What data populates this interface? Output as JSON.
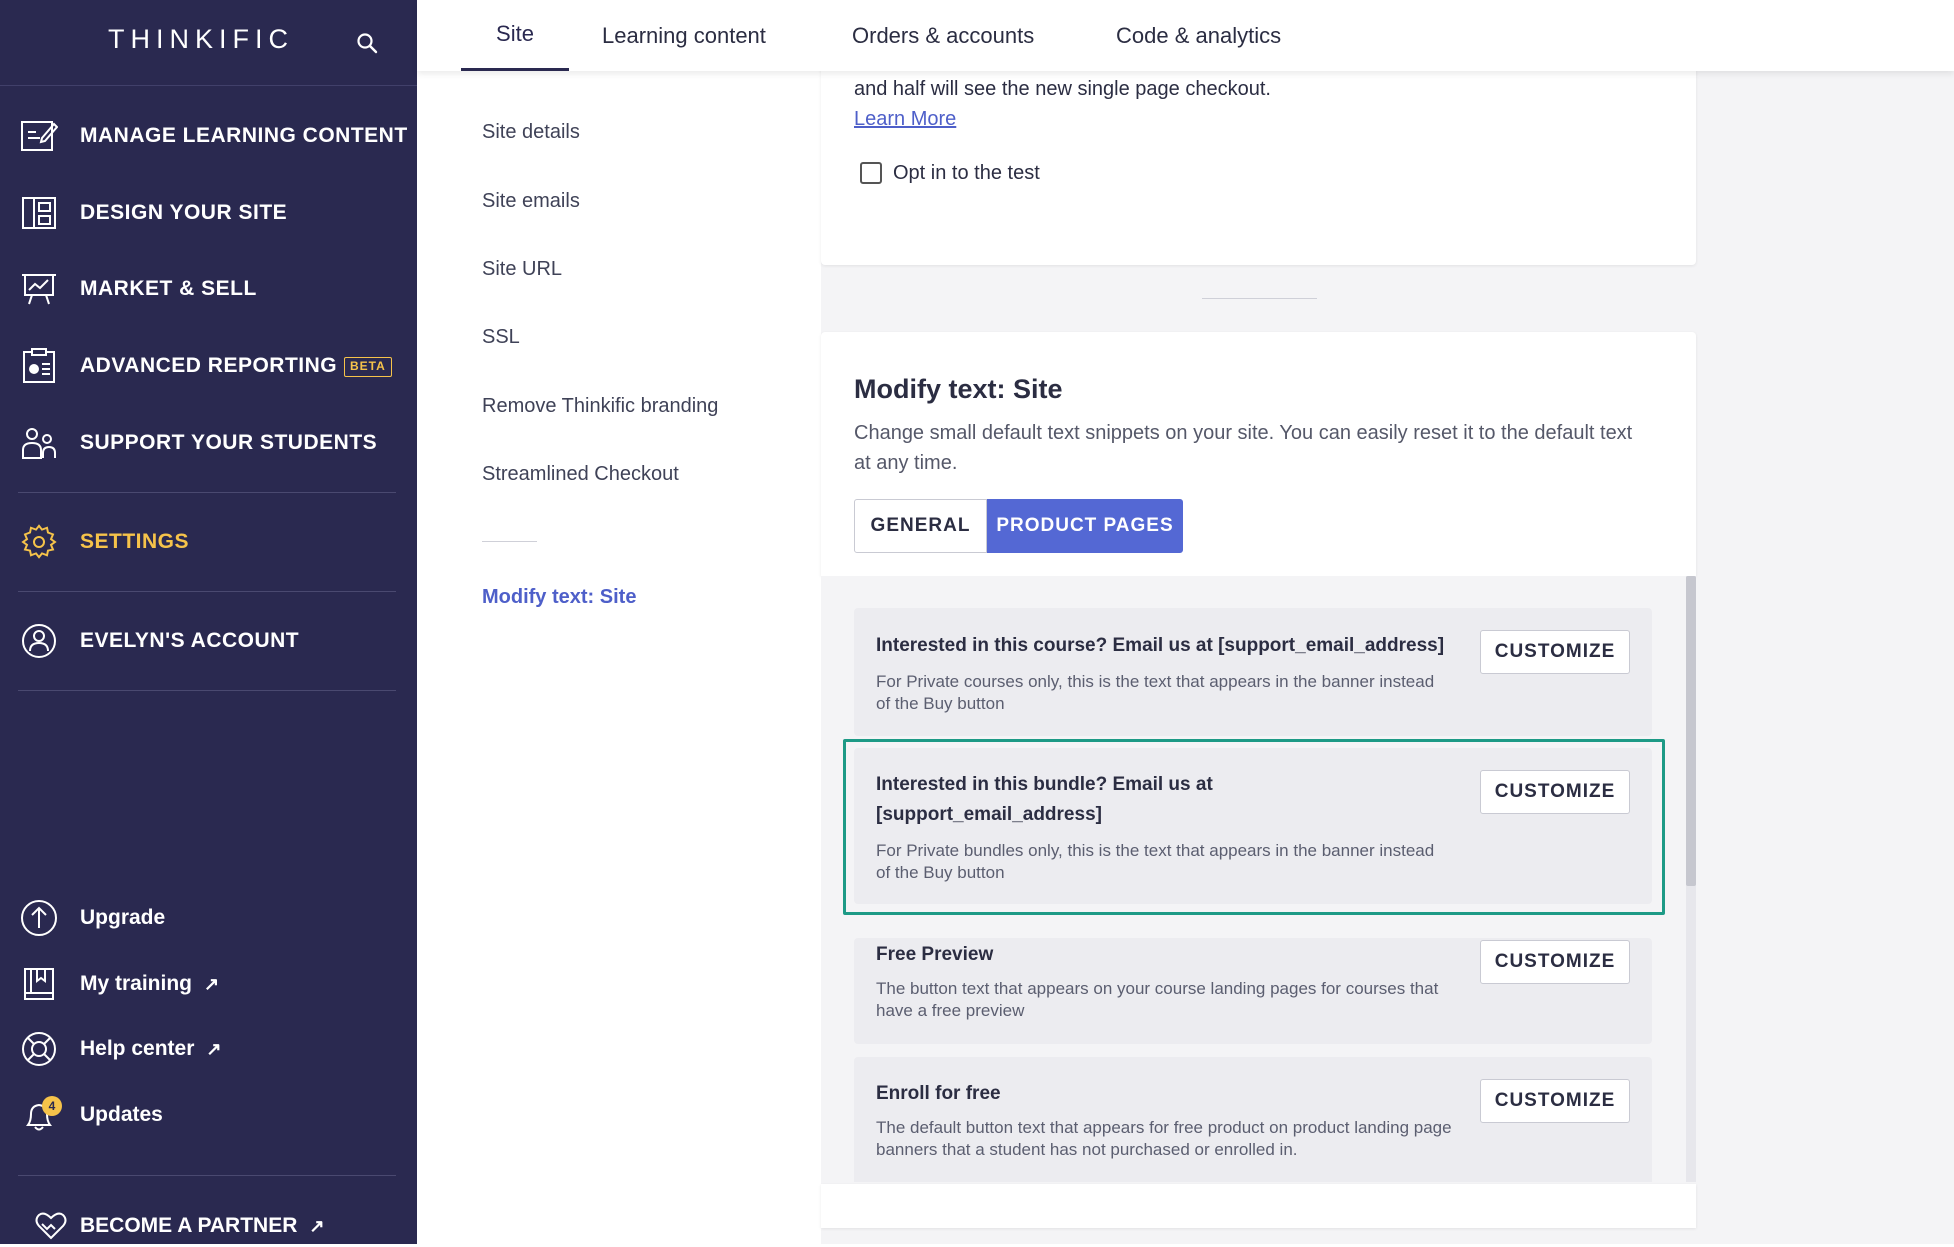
{
  "sidebar": {
    "logo": "THINKIFIC",
    "nav": [
      {
        "label": "MANAGE LEARNING CONTENT"
      },
      {
        "label": "DESIGN YOUR SITE"
      },
      {
        "label": "MARKET & SELL"
      },
      {
        "label": "ADVANCED REPORTING",
        "badge": "BETA"
      },
      {
        "label": "SUPPORT YOUR STUDENTS"
      },
      {
        "label": "SETTINGS"
      },
      {
        "label": "EVELYN'S ACCOUNT"
      }
    ],
    "utility": [
      {
        "label": "Upgrade"
      },
      {
        "label": "My training",
        "ext": "↗"
      },
      {
        "label": "Help center",
        "ext": "↗"
      },
      {
        "label": "Updates",
        "badge": "4"
      }
    ],
    "partner": {
      "label": "BECOME A PARTNER",
      "ext": "↗"
    },
    "colors": {
      "background": "#2a2950",
      "active": "#f6c34a"
    }
  },
  "tabs": [
    "Site",
    "Learning content",
    "Orders & accounts",
    "Code & analytics"
  ],
  "subnav": [
    "Site details",
    "Site emails",
    "Site URL",
    "SSL",
    "Remove Thinkific branding",
    "Streamlined Checkout",
    "Modify text: Site"
  ],
  "checkout_card": {
    "text": "and half will see the new single page checkout.",
    "learn_more": "Learn More",
    "optin_label": "Opt in to the test"
  },
  "modify_text": {
    "title": "Modify text: Site",
    "description": "Change small default text snippets on your site. You can easily reset it to the default text at any time.",
    "toggle_general": "GENERAL",
    "toggle_product": "PRODUCT PAGES",
    "customize_label": "CUSTOMIZE",
    "rows": [
      {
        "title": "Interested in this course? Email us at [support_email_address]",
        "desc": "For Private courses only, this is the text that appears in the banner instead of the Buy button"
      },
      {
        "title": "Interested in this bundle? Email us at [support_email_address]",
        "desc": "For Private bundles only, this is the text that appears in the banner instead of the Buy button"
      },
      {
        "title": "Free Preview",
        "desc": "The button text that appears on your course landing pages for courses that have a free preview"
      },
      {
        "title": "Enroll for free",
        "desc": "The default button text that appears for free product on product landing page banners that a student has not purchased or enrolled in."
      }
    ]
  },
  "colors": {
    "accent": "#5468d4",
    "highlight": "#1d9a86",
    "link": "#4e5fc9"
  }
}
